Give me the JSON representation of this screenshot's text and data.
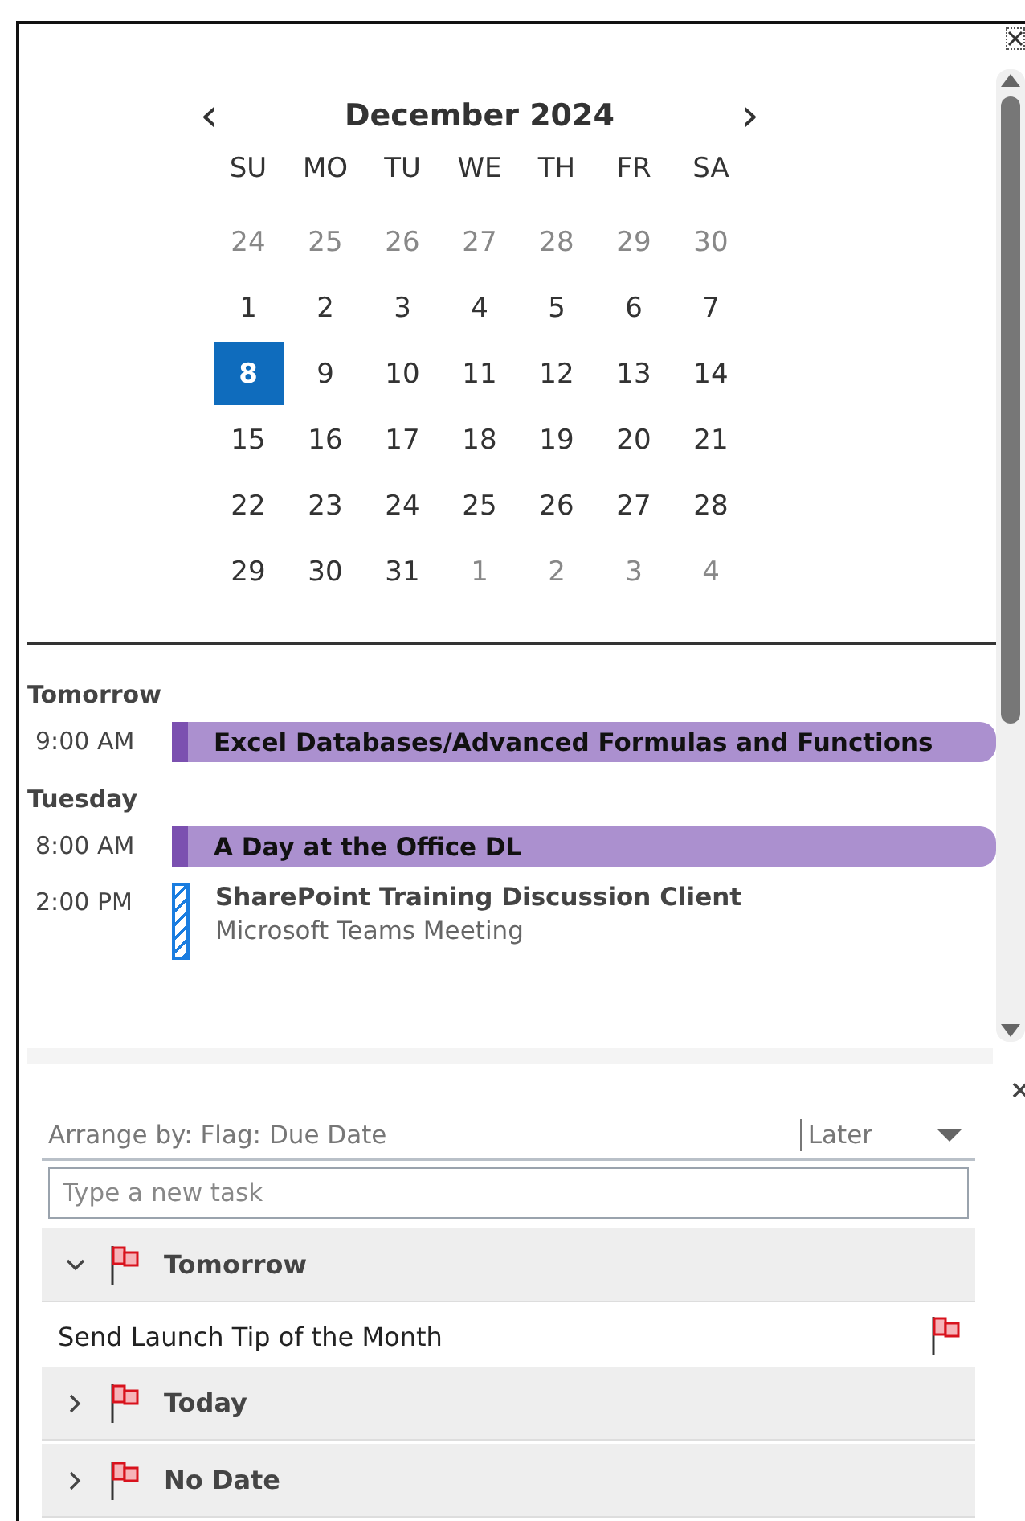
{
  "calendar": {
    "month": "December 2024",
    "prev": "‹",
    "next": "›",
    "weekdays": [
      "SU",
      "MO",
      "TU",
      "WE",
      "TH",
      "FR",
      "SA"
    ],
    "weeks": [
      [
        {
          "d": "24",
          "muted": true,
          "selected": false
        },
        {
          "d": "25",
          "muted": true,
          "selected": false
        },
        {
          "d": "26",
          "muted": true,
          "selected": false
        },
        {
          "d": "27",
          "muted": true,
          "selected": false
        },
        {
          "d": "28",
          "muted": true,
          "selected": false
        },
        {
          "d": "29",
          "muted": true,
          "selected": false
        },
        {
          "d": "30",
          "muted": true,
          "selected": false
        }
      ],
      [
        {
          "d": "1",
          "muted": false,
          "selected": false
        },
        {
          "d": "2",
          "muted": false,
          "selected": false
        },
        {
          "d": "3",
          "muted": false,
          "selected": false
        },
        {
          "d": "4",
          "muted": false,
          "selected": false
        },
        {
          "d": "5",
          "muted": false,
          "selected": false
        },
        {
          "d": "6",
          "muted": false,
          "selected": false
        },
        {
          "d": "7",
          "muted": false,
          "selected": false
        }
      ],
      [
        {
          "d": "8",
          "muted": false,
          "selected": true
        },
        {
          "d": "9",
          "muted": false,
          "selected": false
        },
        {
          "d": "10",
          "muted": false,
          "selected": false
        },
        {
          "d": "11",
          "muted": false,
          "selected": false
        },
        {
          "d": "12",
          "muted": false,
          "selected": false
        },
        {
          "d": "13",
          "muted": false,
          "selected": false
        },
        {
          "d": "14",
          "muted": false,
          "selected": false
        }
      ],
      [
        {
          "d": "15",
          "muted": false,
          "selected": false
        },
        {
          "d": "16",
          "muted": false,
          "selected": false
        },
        {
          "d": "17",
          "muted": false,
          "selected": false
        },
        {
          "d": "18",
          "muted": false,
          "selected": false
        },
        {
          "d": "19",
          "muted": false,
          "selected": false
        },
        {
          "d": "20",
          "muted": false,
          "selected": false
        },
        {
          "d": "21",
          "muted": false,
          "selected": false
        }
      ],
      [
        {
          "d": "22",
          "muted": false,
          "selected": false
        },
        {
          "d": "23",
          "muted": false,
          "selected": false
        },
        {
          "d": "24",
          "muted": false,
          "selected": false
        },
        {
          "d": "25",
          "muted": false,
          "selected": false
        },
        {
          "d": "26",
          "muted": false,
          "selected": false
        },
        {
          "d": "27",
          "muted": false,
          "selected": false
        },
        {
          "d": "28",
          "muted": false,
          "selected": false
        }
      ],
      [
        {
          "d": "29",
          "muted": false,
          "selected": false
        },
        {
          "d": "30",
          "muted": false,
          "selected": false
        },
        {
          "d": "31",
          "muted": false,
          "selected": false
        },
        {
          "d": "1",
          "muted": true,
          "selected": false
        },
        {
          "d": "2",
          "muted": true,
          "selected": false
        },
        {
          "d": "3",
          "muted": true,
          "selected": false
        },
        {
          "d": "4",
          "muted": true,
          "selected": false
        }
      ]
    ]
  },
  "agenda": [
    {
      "day": "Tomorrow",
      "events": [
        {
          "time": "9:00 AM",
          "title": "Excel Databases/Advanced Formulas and Functions",
          "kind": "busy"
        }
      ]
    },
    {
      "day": "Tuesday",
      "events": [
        {
          "time": "8:00 AM",
          "title": "A Day at the Office DL",
          "kind": "busy"
        },
        {
          "time": "2:00 PM",
          "title": "SharePoint Training Discussion Client",
          "subtitle": "Microsoft Teams Meeting",
          "kind": "tentative"
        }
      ]
    }
  ],
  "tasks": {
    "arrange": "Arrange by: Flag: Due Date",
    "sort": "Later",
    "placeholder": "Type a new task",
    "groups": [
      {
        "label": "Tomorrow",
        "expanded": true,
        "items": [
          "Send Launch Tip of the Month"
        ]
      },
      {
        "label": "Today",
        "expanded": false
      },
      {
        "label": "No Date",
        "expanded": false
      }
    ]
  }
}
